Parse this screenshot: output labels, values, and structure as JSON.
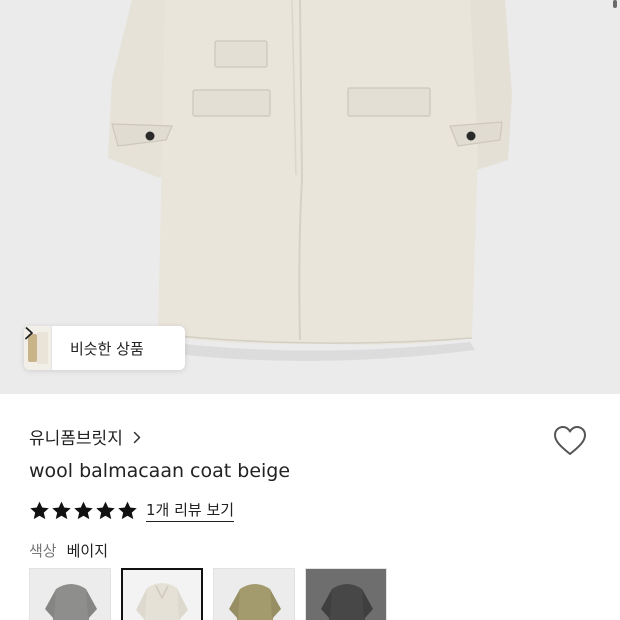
{
  "hero": {
    "image": "beige-wool-balmacaan-coat-photo"
  },
  "similar": {
    "label": "비슷한 상품"
  },
  "product": {
    "brand": "유니폼브릿지",
    "title": "wool balmacaan coat beige",
    "rating_stars": 5,
    "review_link": "1개 리뷰 보기",
    "color_label": "색상",
    "color_value": "베이지"
  },
  "swatches": [
    {
      "color": "gray",
      "hex": "#8e8e8c",
      "selected": false
    },
    {
      "color": "beige",
      "hex": "#e6e1d6",
      "selected": true
    },
    {
      "color": "khaki",
      "hex": "#a39a6e",
      "selected": false
    },
    {
      "color": "charcoal",
      "hex": "#4a4a4a",
      "selected": false
    }
  ],
  "colors": {
    "hero_bg": "#ebebeb",
    "coat": "#e8e4da",
    "text": "#222222",
    "muted": "#777777"
  },
  "icons": [
    "chevron-right-icon",
    "heart-icon",
    "star-icon"
  ]
}
